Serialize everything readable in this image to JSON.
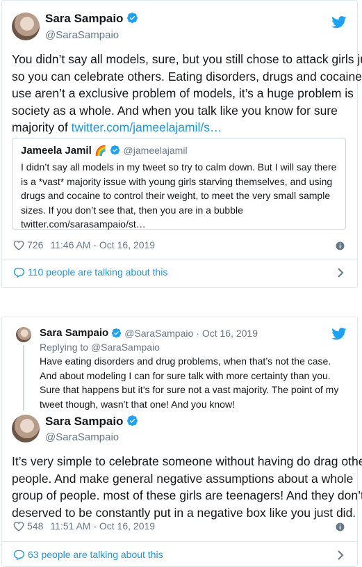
{
  "tweet1": {
    "author_name": "Sara Sampaio",
    "author_handle": "@SaraSampaio",
    "body_lines": [
      "You didn’t say all models, sure, but you still chose to attack girls just",
      "so you can celebrate others. Eating disorders, drugs and cocaine",
      "use aren’t a exclusive problem of models, it’s a huge problem is",
      "society as a whole. And when you talk like you know for sure"
    ],
    "body_last_prefix": "majority of ",
    "body_link": "twitter.com/jameelajamil/s…",
    "quote": {
      "author_name": "Jameela Jamil",
      "author_emoji": "🌈",
      "author_handle": "@jameelajamil",
      "lines": [
        "I didn’t say all models in my tweet so try to calm down. But I will say there",
        "is a *vast* majority issue with young girls starving themselves, and using",
        "drugs and cocaine to control their weight, to meet the very small sample",
        "sizes. If you don’t see that, then you are in a bubble",
        "twitter.com/sarasampaio/st…"
      ]
    },
    "likes": "726",
    "timestamp": "11:46 AM - Oct 16, 2019",
    "talking": "110 people are talking about this"
  },
  "tweet2": {
    "reply": {
      "author_name": "Sara Sampaio",
      "author_handle": "@SaraSampaio",
      "date": "· Oct 16, 2019",
      "replying_to": "Replying to @SaraSampaio",
      "lines": [
        "Have eating disorders and drug problems, when that’s not the case.",
        "And about modeling I can for sure talk with more certainty than you.",
        "Sure that happens but it’s for sure not a vast majority. The point of my",
        "tweet though, wasn’t that one! And you know!"
      ]
    },
    "author_name": "Sara Sampaio",
    "author_handle": "@SaraSampaio",
    "body_lines": [
      "It’s very simple to celebrate someone without having do drag other",
      "people. And make general negative assumptions about a whole",
      "group of people. most of these girls are teenagers! And they don’t",
      "deserved to be constantly put in a negative box like you just did."
    ],
    "likes": "548",
    "timestamp": "11:51 AM - Oct 16, 2019",
    "talking": "63 people are talking about this"
  },
  "colors": {
    "accent": "#1b95e0",
    "like_gray": "#657786",
    "verified": "#1da1f2"
  },
  "icons": [
    "verified-badge-icon",
    "twitter-bird-icon",
    "heart-icon",
    "info-icon",
    "comment-icon",
    "chevron-right-icon"
  ]
}
